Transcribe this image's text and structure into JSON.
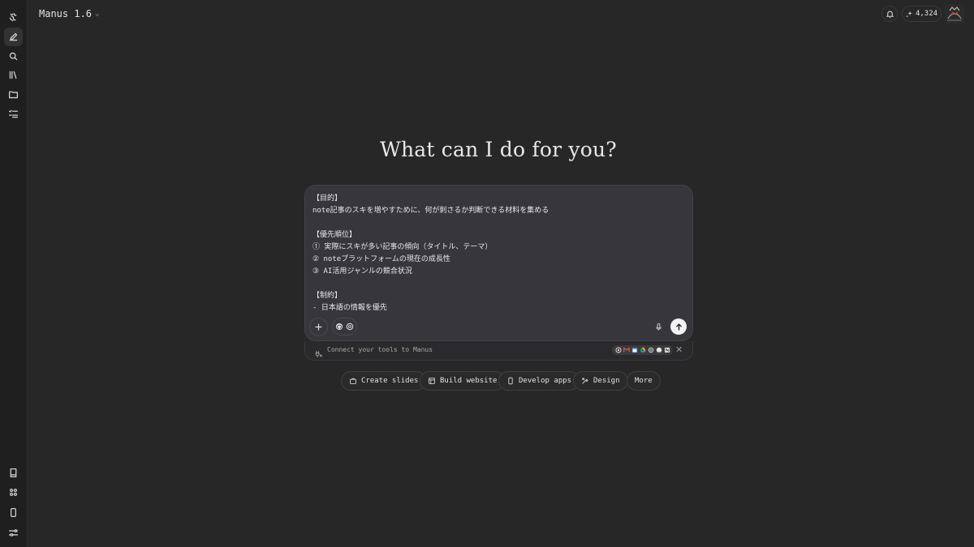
{
  "app": {
    "title": "Manus 1.6",
    "credits": "4,324"
  },
  "sidebar": {
    "top_items": [
      {
        "name": "new-task",
        "icon": "edit-icon"
      },
      {
        "name": "search",
        "icon": "search-icon"
      },
      {
        "name": "library",
        "icon": "library-icon"
      },
      {
        "name": "files",
        "icon": "folder-icon"
      },
      {
        "name": "tasks",
        "icon": "task-list-icon"
      }
    ],
    "bottom_items": [
      {
        "name": "docs",
        "icon": "book-icon"
      },
      {
        "name": "apps",
        "icon": "grid-icon"
      },
      {
        "name": "mobile",
        "icon": "phone-icon"
      },
      {
        "name": "settings",
        "icon": "sliders-icon"
      }
    ]
  },
  "main": {
    "heading": "What can I do for you?",
    "composer": {
      "text": "【目的】\nnote記事のスキを増やすために、何が刺さるか判断できる材料を集める\n\n【優先順位】\n① 実際にスキが多い記事の傾向（タイトル、テーマ）\n② noteプラットフォームの現在の成長性\n③ AI活用ジャンルの競合状況\n\n【制約】\n- 日本語の情報を優先"
    },
    "connect": {
      "text": "Connect your tools to Manus"
    },
    "quick_actions": [
      {
        "label": "Create slides",
        "icon": "slides-icon"
      },
      {
        "label": "Build website",
        "icon": "website-icon"
      },
      {
        "label": "Develop apps",
        "icon": "phone-icon"
      },
      {
        "label": "Design",
        "icon": "design-icon"
      },
      {
        "label": "More",
        "icon": ""
      }
    ]
  },
  "colors": {
    "background": "#272727",
    "sidebar": "#1f1f1f",
    "composer": "#37363a",
    "send_button": "#f2f2f2"
  }
}
